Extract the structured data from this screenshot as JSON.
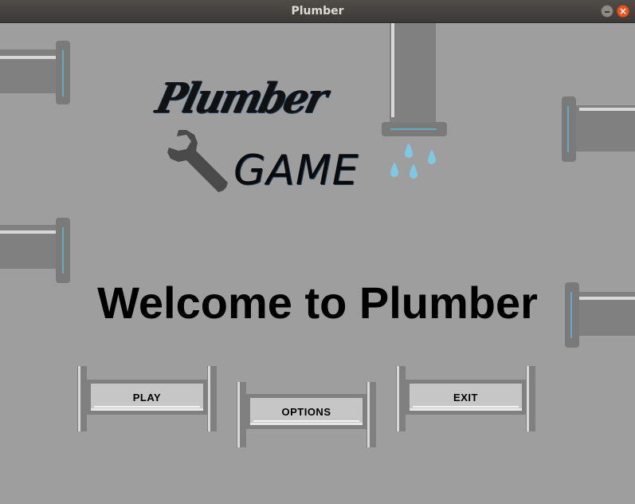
{
  "window": {
    "title": "Plumber"
  },
  "logo": {
    "line1": "Plumber",
    "line2": "GAME"
  },
  "heading": "Welcome to Plumber",
  "buttons": {
    "play": "PLAY",
    "options": "OPTIONS",
    "exit": "EXIT"
  },
  "colors": {
    "background": "#9e9e9e",
    "pipe": "#808080",
    "pipe_highlight": "#d8d8d8",
    "water": "#7ec8e3",
    "button_face": "#c6c6c6"
  }
}
